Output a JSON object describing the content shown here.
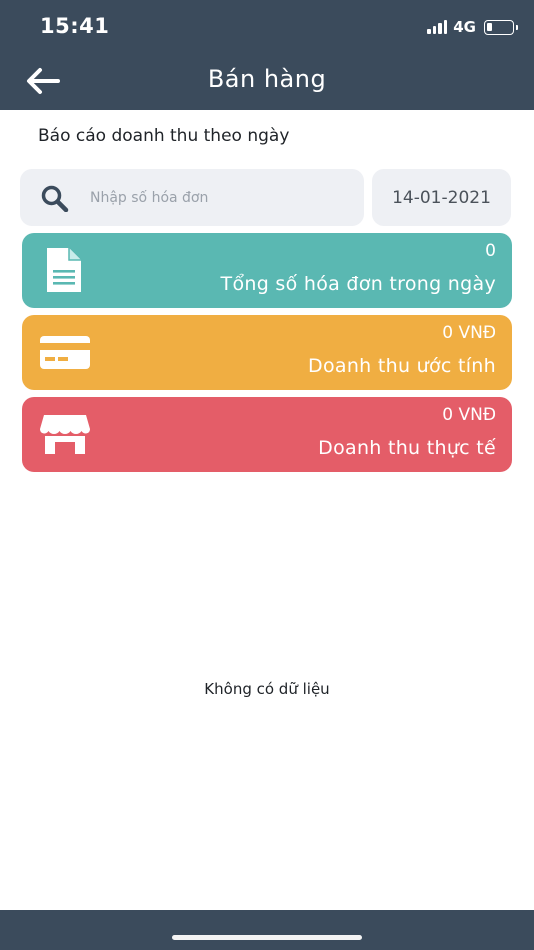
{
  "status_bar": {
    "time": "15:41",
    "network": "4G"
  },
  "header": {
    "title": "Bán hàng",
    "back_icon": "arrow-left-icon"
  },
  "report": {
    "title": "Báo cáo doanh thu theo ngày"
  },
  "search": {
    "placeholder": "Nhập số hóa đơn",
    "value": "",
    "icon": "search-icon"
  },
  "date_filter": {
    "value": "14-01-2021"
  },
  "summary_cards": [
    {
      "value": "0",
      "label": "Tổng số hóa đơn trong ngày",
      "color": "#5ab8b2",
      "icon": "document-icon"
    },
    {
      "value": "0 VNĐ",
      "label": "Doanh thu ước tính",
      "color": "#f0ae42",
      "icon": "credit-card-icon"
    },
    {
      "value": "0 VNĐ",
      "label": "Doanh thu thực tế",
      "color": "#e45d68",
      "icon": "store-icon"
    }
  ],
  "empty_state": {
    "message": "Không có dữ liệu"
  },
  "colors": {
    "header_bg": "#3b4b5c",
    "input_bg": "#eef0f4"
  }
}
